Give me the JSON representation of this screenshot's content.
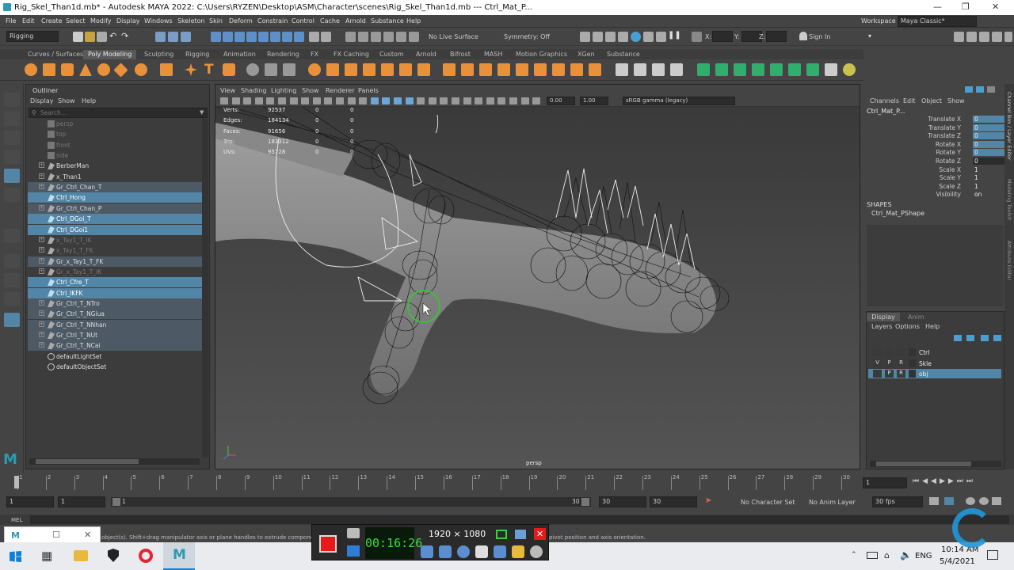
{
  "window": {
    "title": "Rig_Skel_Than1d.mb* - Autodesk MAYA 2022: C:\\Users\\RYZEN\\Desktop\\ASM\\Character\\scenes\\Rig_Skel_Than1d.mb  ---  Ctrl_Mat_P..."
  },
  "menu": [
    "File",
    "Edit",
    "Create",
    "Select",
    "Modify",
    "Display",
    "Windows",
    "Skeleton",
    "Skin",
    "Deform",
    "Constrain",
    "Control",
    "Cache",
    "Arnold",
    "Substance",
    "Help"
  ],
  "workspace": {
    "label": "Workspace :",
    "value": "Maya Classic*"
  },
  "status": {
    "menuset": "Rigging",
    "live_surface": "No Live Surface",
    "symmetry": "Symmetry: Off",
    "x": "X:",
    "y": "Y:",
    "z": "Z:",
    "sign_in": "Sign In"
  },
  "shelf_tabs": [
    "Curves / Surfaces",
    "Poly Modeling",
    "Sculpting",
    "Rigging",
    "Animation",
    "Rendering",
    "FX",
    "FX Caching",
    "Custom",
    "Arnold",
    "Bifrost",
    "MASH",
    "Motion Graphics",
    "XGen",
    "Substance"
  ],
  "shelf_active": "Poly Modeling",
  "outliner": {
    "title": "Outliner",
    "menu": [
      "Display",
      "Show",
      "Help"
    ],
    "search_placeholder": "Search...",
    "items": [
      {
        "name": "persp",
        "state": "dim",
        "expand": ""
      },
      {
        "name": "top",
        "state": "dim",
        "expand": ""
      },
      {
        "name": "front",
        "state": "dim",
        "expand": ""
      },
      {
        "name": "side",
        "state": "dim",
        "expand": ""
      },
      {
        "name": "BerberMan",
        "state": "",
        "expand": "+"
      },
      {
        "name": "x_Than1",
        "state": "",
        "expand": "+"
      },
      {
        "name": "Gr_Ctrl_Chan_T",
        "state": "hl",
        "expand": "+"
      },
      {
        "name": "Ctrl_Hong",
        "state": "sel",
        "expand": ""
      },
      {
        "name": "Gr_Ctrl_Chan_P",
        "state": "hl",
        "expand": "+"
      },
      {
        "name": "Ctrl_DGoi_T",
        "state": "sel",
        "expand": ""
      },
      {
        "name": "Ctrl_DGoi1",
        "state": "sel",
        "expand": ""
      },
      {
        "name": "x_Tay1_T_IK",
        "state": "dim",
        "expand": "+"
      },
      {
        "name": "x_Tay1_T_FK",
        "state": "dim",
        "expand": "+"
      },
      {
        "name": "Gr_x_Tay1_T_FK",
        "state": "hl",
        "expand": "+"
      },
      {
        "name": "Gr_x_Tay1_T_IK",
        "state": "dim",
        "expand": "+"
      },
      {
        "name": "Ctrl_Cfre_T",
        "state": "sel",
        "expand": ""
      },
      {
        "name": "Ctrl_IKFK",
        "state": "sel",
        "expand": ""
      },
      {
        "name": "Gr_Ctrl_T_NTro",
        "state": "hl",
        "expand": "+"
      },
      {
        "name": "Gr_Ctrl_T_NGiua",
        "state": "hl",
        "expand": "+"
      },
      {
        "name": "Gr_Ctrl_T_NNhan",
        "state": "hl",
        "expand": "+"
      },
      {
        "name": "Gr_Ctrl_T_NUt",
        "state": "hl",
        "expand": "+"
      },
      {
        "name": "Gr_Ctrl_T_NCai",
        "state": "hl",
        "expand": "+"
      },
      {
        "name": "defaultLightSet",
        "state": "",
        "expand": ""
      },
      {
        "name": "defaultObjectSet",
        "state": "",
        "expand": ""
      }
    ]
  },
  "viewport": {
    "menu": [
      "View",
      "Shading",
      "Lighting",
      "Show",
      "Renderer",
      "Panels"
    ],
    "exposure": "0.00",
    "gamma": "1.00",
    "colorspace": "sRGB gamma (legacy)",
    "camera": "persp",
    "hud": [
      {
        "label": "Verts:",
        "v1": "92537",
        "v2": "0",
        "v3": "0"
      },
      {
        "label": "Edges:",
        "v1": "184134",
        "v2": "0",
        "v3": "0"
      },
      {
        "label": "Faces:",
        "v1": "91656",
        "v2": "0",
        "v3": "0"
      },
      {
        "label": "Tris:",
        "v1": "183312",
        "v2": "0",
        "v3": "0"
      },
      {
        "label": "UVs:",
        "v1": "95728",
        "v2": "0",
        "v3": "0"
      }
    ]
  },
  "channelbox": {
    "menu": [
      "Channels",
      "Edit",
      "Object",
      "Show"
    ],
    "object": "Ctrl_Mat_P...",
    "channels": [
      {
        "name": "Translate X",
        "value": "0",
        "style": "ch"
      },
      {
        "name": "Translate Y",
        "value": "0",
        "style": "ch"
      },
      {
        "name": "Translate Z",
        "value": "0",
        "style": "ch"
      },
      {
        "name": "Rotate X",
        "value": "0",
        "style": "ch"
      },
      {
        "name": "Rotate Y",
        "value": "0",
        "style": "ch"
      },
      {
        "name": "Rotate Z",
        "value": "0",
        "style": "pl"
      },
      {
        "name": "Scale X",
        "value": "1",
        "style": ""
      },
      {
        "name": "Scale Y",
        "value": "1",
        "style": ""
      },
      {
        "name": "Scale Z",
        "value": "1",
        "style": ""
      },
      {
        "name": "Visibility",
        "value": "on",
        "style": ""
      }
    ],
    "shapes_title": "SHAPES",
    "shape": "Ctrl_Mat_PShape"
  },
  "layers": {
    "tabs": [
      "Display",
      "Anim"
    ],
    "menu": [
      "Layers",
      "Options",
      "Help"
    ],
    "rows": [
      {
        "v": "",
        "p": "",
        "r": "",
        "name": "Ctrl",
        "sel": false
      },
      {
        "v": "V",
        "p": "P",
        "r": "R",
        "name": "Skle",
        "sel": false
      },
      {
        "v": "",
        "p": "P",
        "r": "R",
        "name": "obj",
        "sel": true
      }
    ]
  },
  "side_tabs": [
    "Channel Box / Layer Editor",
    "Modeling Toolkit",
    "Attribute Editor"
  ],
  "time": {
    "ticks": [
      "1",
      "2",
      "3",
      "4",
      "5",
      "6",
      "7",
      "8",
      "9",
      "10",
      "11",
      "12",
      "13",
      "14",
      "15",
      "16",
      "17",
      "18",
      "19",
      "20",
      "21",
      "22",
      "23",
      "24",
      "25",
      "26",
      "27",
      "28",
      "29",
      "30"
    ],
    "current": "1",
    "range_start": "1",
    "range_inner_start": "1",
    "range_slider_label": "1",
    "range_inner_end": "30",
    "range_end": "30",
    "anim_end": "30",
    "character_set": "No Character Set",
    "anim_layer": "No Anim Layer",
    "fps": "30 fps"
  },
  "cmd": {
    "label": "MEL"
  },
  "help": {
    "left": "object(s). Shift+drag manipulator axis or plane handles to extrude components or clone ob",
    "right": "pivot position and axis orientation."
  },
  "recorder": {
    "timer": "00:16:26",
    "resolution": "1920 × 1080"
  },
  "taskbar": {
    "lang": "ENG",
    "time": "10:14 AM",
    "date": "5/4/2021"
  }
}
